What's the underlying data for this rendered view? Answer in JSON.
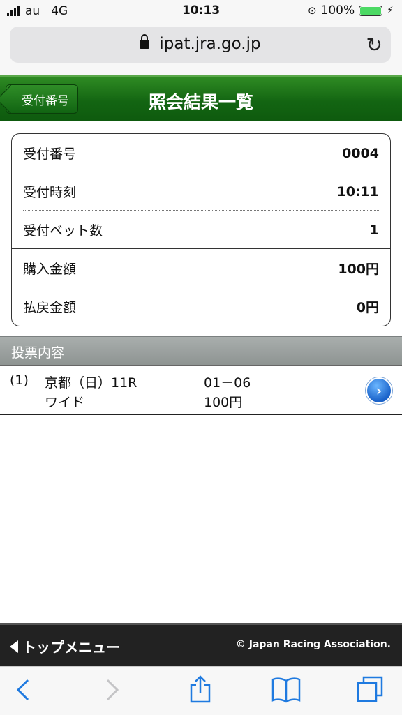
{
  "status_bar": {
    "carrier": "au",
    "network": "4G",
    "time": "10:13",
    "battery": "100%",
    "battery_level": 1.0
  },
  "url_bar": {
    "url": "ipat.jra.go.jp"
  },
  "header": {
    "back_label": "受付番号",
    "title": "照会結果一覧"
  },
  "receipt": {
    "rows": [
      {
        "label": "受付番号",
        "value": "0004"
      },
      {
        "label": "受付時刻",
        "value": "10:11"
      },
      {
        "label": "受付ベット数",
        "value": "1"
      },
      {
        "label": "購入金額",
        "value": "100円"
      },
      {
        "label": "払戻金額",
        "value": "0円"
      }
    ]
  },
  "section": {
    "title": "投票内容"
  },
  "bets": [
    {
      "index": "(1)",
      "race": "京都（日）11R",
      "combination": "01－06",
      "bet_type": "ワイド",
      "amount": "100円"
    }
  ],
  "footer": {
    "top_menu": "トップメニュー",
    "copyright": "© Japan Racing Association."
  },
  "colors": {
    "header_green": "#136512",
    "section_gray": "#9a9f9e",
    "link_blue": "#1f7ae0"
  }
}
